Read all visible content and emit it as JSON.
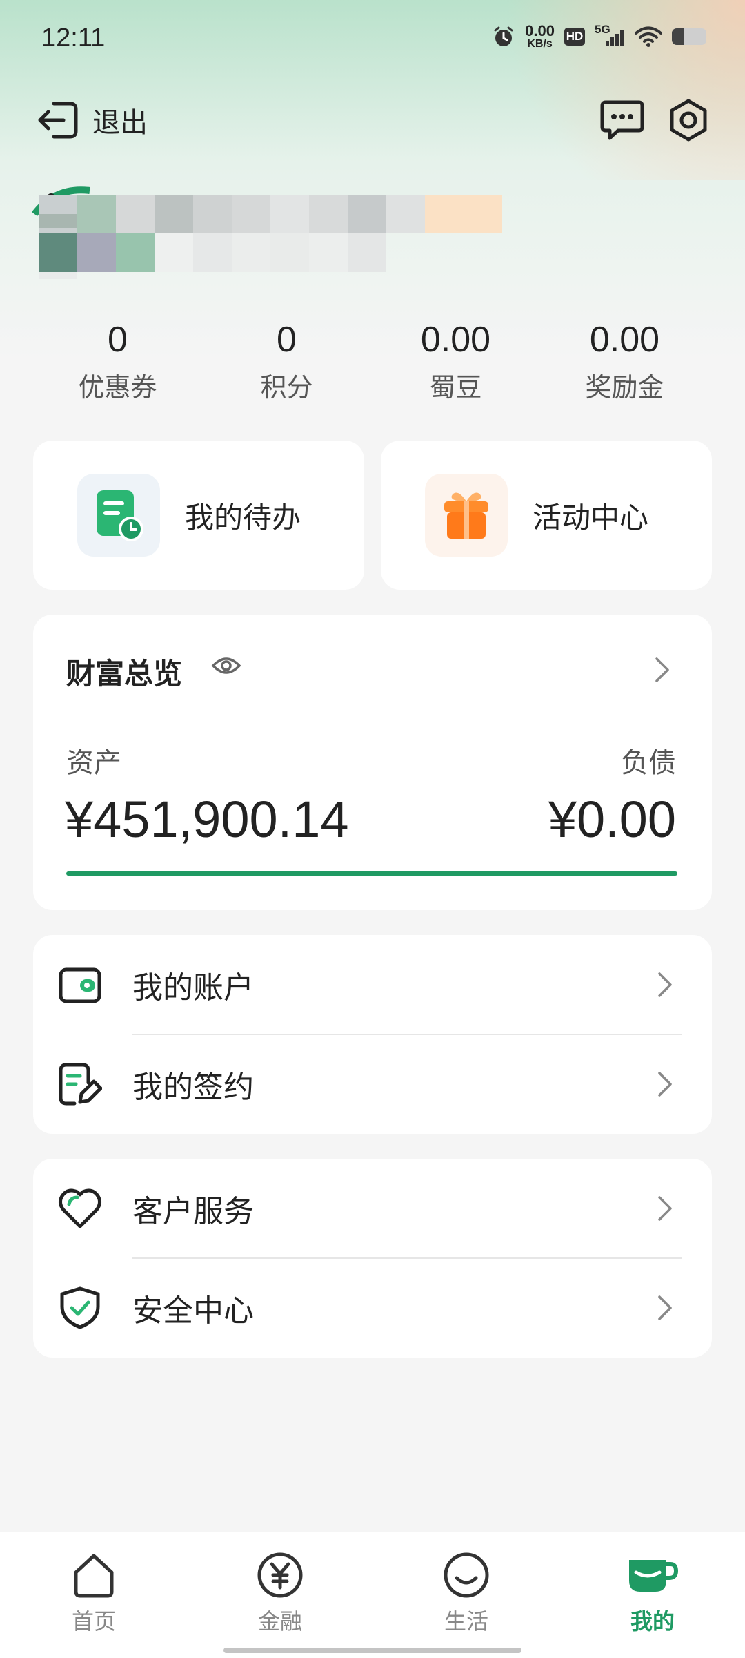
{
  "status_bar": {
    "time": "12:11",
    "net_speed_value": "0.00",
    "net_speed_unit": "KB/s",
    "hd_badge": "HD",
    "network": "5G",
    "battery_level": 0.35
  },
  "header": {
    "exit_label": "退出",
    "icons": [
      "exit-icon",
      "message-icon",
      "settings-icon"
    ]
  },
  "stats": [
    {
      "value": "0",
      "label": "优惠券"
    },
    {
      "value": "0",
      "label": "积分"
    },
    {
      "value": "0.00",
      "label": "蜀豆"
    },
    {
      "value": "0.00",
      "label": "奖励金"
    }
  ],
  "shortcuts": [
    {
      "label": "我的待办",
      "icon": "todo-icon"
    },
    {
      "label": "活动中心",
      "icon": "gift-icon"
    }
  ],
  "wealth": {
    "title": "财富总览",
    "assets_label": "资产",
    "assets_value": "¥451,900.14",
    "debt_label": "负债",
    "debt_value": "¥0.00",
    "accent_color": "#1f9a63"
  },
  "menu_group_1": [
    {
      "label": "我的账户",
      "icon": "wallet-icon"
    },
    {
      "label": "我的签约",
      "icon": "contract-icon"
    }
  ],
  "menu_group_2": [
    {
      "label": "客户服务",
      "icon": "heart-icon"
    },
    {
      "label": "安全中心",
      "icon": "shield-icon"
    }
  ],
  "bottom_nav": [
    {
      "label": "首页",
      "icon": "home-icon",
      "active": false
    },
    {
      "label": "金融",
      "icon": "yuan-icon",
      "active": false
    },
    {
      "label": "生活",
      "icon": "smile-icon",
      "active": false
    },
    {
      "label": "我的",
      "icon": "cup-icon",
      "active": true
    }
  ]
}
